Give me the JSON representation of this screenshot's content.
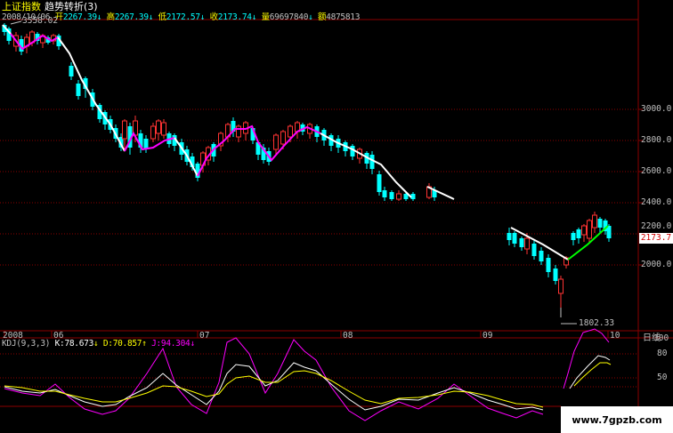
{
  "header": {
    "index_name": "上证指数",
    "indicator_name": "趋势转折(3)",
    "date": "2008/10/06",
    "open_label": "开",
    "open_value": "2267.39",
    "high_label": "高",
    "high_value": "2267.39",
    "low_label": "低",
    "low_value": "2172.57",
    "close_label": "收",
    "close_value": "2173.74",
    "volume_label": "量",
    "volume_value": "69697840",
    "amount_label": "额",
    "amount_value": "4875813",
    "arrow": "↓"
  },
  "price_axis": [
    "3000.0",
    "2800.0",
    "2600.0",
    "2400.0",
    "2200.0",
    "2000.0"
  ],
  "current_price": "2173.7",
  "max_label": "3558.02",
  "min_label": "1802.33",
  "time_axis": [
    "2008",
    "06",
    "07",
    "08",
    "09",
    "10"
  ],
  "period_label": "日线",
  "kdj": {
    "name": "KDJ(9,3,3)",
    "k_label": "K:",
    "k_value": "78.673",
    "d_label": "D:",
    "d_value": "70.857",
    "j_label": "J:",
    "j_value": "94.304",
    "k_arrow": "↓",
    "d_arrow": "↑",
    "j_arrow": "↓",
    "axis": [
      "100",
      "80",
      "50"
    ]
  },
  "watermark": "www.7gpzb.com",
  "colors": {
    "background": "#000000",
    "grid": "#8b0000",
    "title": "#ffff00",
    "trend_line": "#ffffff",
    "trend_magenta": "#ff00ff",
    "trend_green": "#00ff00",
    "candle_up": "#ff3333",
    "candle_down": "#00ffff",
    "k_line": "#ffffff",
    "d_line": "#ffff00",
    "j_line": "#ff00ff"
  }
}
